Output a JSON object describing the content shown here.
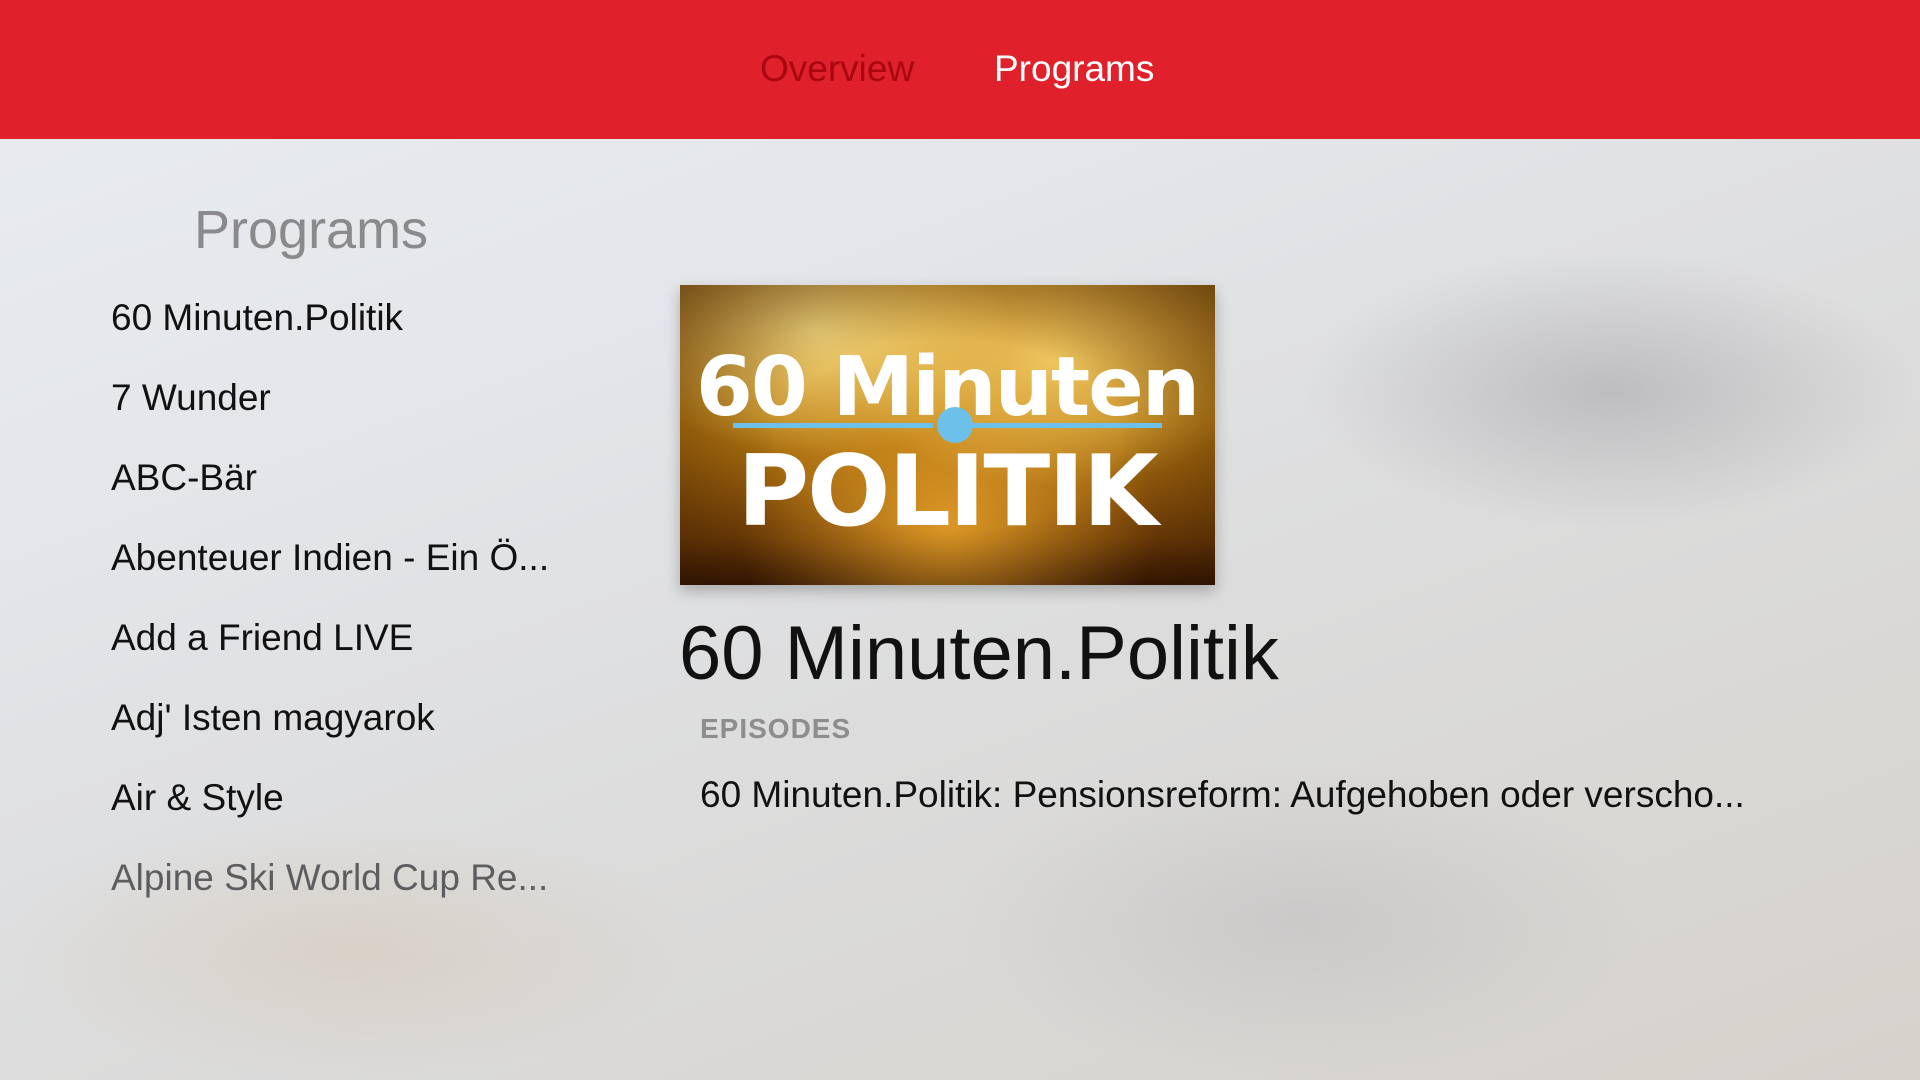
{
  "topbar": {
    "tabs": [
      {
        "label": "Overview",
        "selected": true
      },
      {
        "label": "Programs",
        "selected": false
      }
    ],
    "accent_color": "#e0212b"
  },
  "sidebar": {
    "title": "Programs",
    "items": [
      {
        "label": "60 Minuten.Politik"
      },
      {
        "label": "7 Wunder"
      },
      {
        "label": "ABC-Bär"
      },
      {
        "label": "Abenteuer Indien - Ein Ö..."
      },
      {
        "label": "Add a Friend LIVE"
      },
      {
        "label": "Adj' Isten magyarok"
      },
      {
        "label": "Air & Style"
      },
      {
        "label": "Alpine Ski World Cup Re..."
      }
    ]
  },
  "detail": {
    "artwork": {
      "line1": "60 Minuten",
      "line2": "POLITIK",
      "dot_color": "#6cc0ea"
    },
    "title": "60 Minuten.Politik",
    "episodes_label": "EPISODES",
    "episodes": [
      {
        "label": "60 Minuten.Politik: Pensionsreform: Aufgehoben oder verscho..."
      }
    ]
  }
}
